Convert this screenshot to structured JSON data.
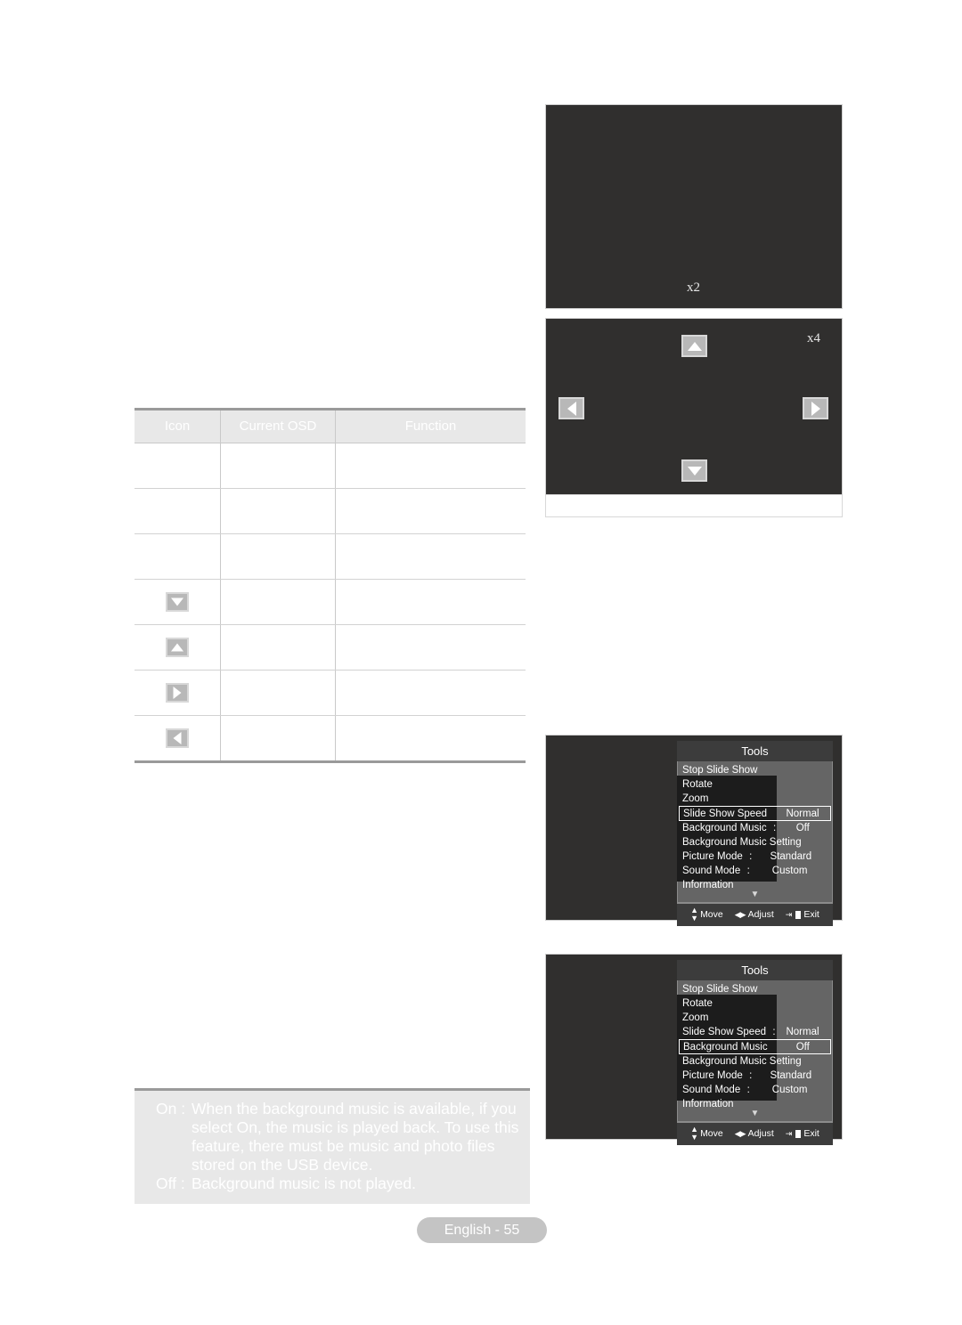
{
  "table": {
    "headers": [
      "Icon",
      "Current OSD",
      "Function"
    ],
    "rows": [
      {
        "icon": "",
        "osd": "",
        "function": ""
      },
      {
        "icon": "",
        "osd": "",
        "function": ""
      },
      {
        "icon": "",
        "osd": "",
        "function": ""
      },
      {
        "icon": "triangle-down",
        "osd": "",
        "function": ""
      },
      {
        "icon": "triangle-up",
        "osd": "",
        "function": ""
      },
      {
        "icon": "triangle-right",
        "osd": "",
        "function": ""
      },
      {
        "icon": "triangle-left",
        "osd": "",
        "function": ""
      }
    ]
  },
  "note": {
    "on_key": "On :",
    "on_text": "When the background music is available, if you select On, the music is played back. To use this feature, there must be music and photo files stored on the USB device.",
    "off_key": "Off :",
    "off_text": "Background music is not played."
  },
  "footer": {
    "page_label": "English - 55"
  },
  "screens": {
    "zoom_x2": "x2",
    "zoom_x4": "x4"
  },
  "osd": {
    "title": "Tools",
    "hints": {
      "move": "Move",
      "adjust": "Adjust",
      "exit": "Exit"
    },
    "menu_1": {
      "items": [
        {
          "label": "Stop Slide Show",
          "colon": "",
          "value": "",
          "selected": false
        },
        {
          "label": "Rotate",
          "colon": "",
          "value": "",
          "selected": false
        },
        {
          "label": "Zoom",
          "colon": "",
          "value": "",
          "selected": false
        },
        {
          "label": "Slide Show Speed",
          "colon": "",
          "value": "Normal",
          "selected": true
        },
        {
          "label": "Background Music",
          "colon": ":",
          "value": "Off",
          "selected": false
        },
        {
          "label": "Background Music Setting",
          "colon": "",
          "value": "",
          "selected": false
        },
        {
          "label": "Picture Mode",
          "colon": ":",
          "value": "Standard",
          "selected": false
        },
        {
          "label": "Sound Mode",
          "colon": ":",
          "value": "Custom",
          "selected": false
        },
        {
          "label": "Information",
          "colon": "",
          "value": "",
          "selected": false
        }
      ]
    },
    "menu_2": {
      "items": [
        {
          "label": "Stop Slide Show",
          "colon": "",
          "value": "",
          "selected": false
        },
        {
          "label": "Rotate",
          "colon": "",
          "value": "",
          "selected": false
        },
        {
          "label": "Zoom",
          "colon": "",
          "value": "",
          "selected": false
        },
        {
          "label": "Slide Show Speed",
          "colon": ":",
          "value": "Normal",
          "selected": false
        },
        {
          "label": "Background Music",
          "colon": "",
          "value": "Off",
          "selected": true
        },
        {
          "label": "Background Music Setting",
          "colon": "",
          "value": "",
          "selected": false
        },
        {
          "label": "Picture Mode",
          "colon": ":",
          "value": "Standard",
          "selected": false
        },
        {
          "label": "Sound Mode",
          "colon": ":",
          "value": "Custom",
          "selected": false
        },
        {
          "label": "Information",
          "colon": "",
          "value": "",
          "selected": false
        }
      ]
    }
  },
  "colors": {
    "screen_bg": "#302f2e",
    "osd_body": "#656565",
    "osd_title": "#3c3c3c",
    "note_bg": "#e8e8e8",
    "footer_bg": "#c4c4c4"
  }
}
